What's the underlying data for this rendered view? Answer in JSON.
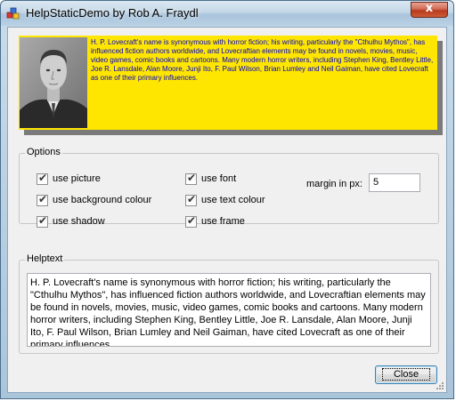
{
  "window": {
    "title": "HelpStaticDemo by Rob A. Fraydl",
    "close_glyph": "x"
  },
  "preview": {
    "background_color": "#ffe600",
    "text_color": "#0000d0",
    "shadow_color": "#7a7a7a",
    "text": "H. P. Lovecraft's name is synonymous with horror fiction; his writing, particularly the \"Cthulhu Mythos\", has influenced fiction authors worldwide, and Lovecraftian elements may be found in novels, movies, music, video games, comic books and cartoons. Many modern horror writers, including Stephen King, Bentley Little, Joe R. Lansdale, Alan Moore, Junji Ito, F. Paul Wilson, Brian Lumley and Neil Gaiman, have cited Lovecraft as one of their primary influences."
  },
  "options": {
    "title": "Options",
    "checkboxes": [
      {
        "label": "use picture",
        "checked": true
      },
      {
        "label": "use background colour",
        "checked": true
      },
      {
        "label": "use shadow",
        "checked": true
      },
      {
        "label": "use font",
        "checked": true
      },
      {
        "label": "use text colour",
        "checked": true
      },
      {
        "label": "use frame",
        "checked": true
      }
    ],
    "margin_label": "margin in px:",
    "margin_value": "5"
  },
  "helptext": {
    "title": "Helptext",
    "value": "H. P. Lovecraft's name is synonymous with horror fiction; his writing, particularly the \"Cthulhu Mythos\", has influenced fiction authors worldwide, and Lovecraftian elements may be found in novels, movies, music, video games, comic books and cartoons. Many modern horror writers, including Stephen King, Bentley Little, Joe R. Lansdale, Alan Moore, Junji Ito, F. Paul Wilson, Brian Lumley and Neil Gaiman, have cited Lovecraft as one of their primary influences."
  },
  "buttons": {
    "close_label": "Close"
  }
}
